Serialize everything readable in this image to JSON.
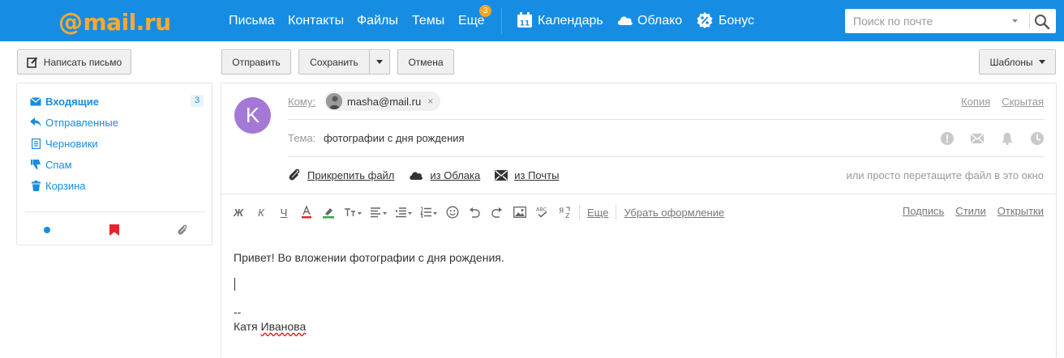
{
  "header": {
    "logo": {
      "at": "@",
      "name": "mail",
      "domain": ".ru"
    },
    "nav": [
      {
        "label": "Письма"
      },
      {
        "label": "Контакты"
      },
      {
        "label": "Файлы"
      },
      {
        "label": "Темы"
      },
      {
        "label": "Еще",
        "badge": "3"
      }
    ],
    "services": [
      {
        "label": "Календарь",
        "icon": "calendar-icon",
        "icon_text": "11"
      },
      {
        "label": "Облако",
        "icon": "cloud-icon"
      },
      {
        "label": "Бонус",
        "icon": "bonus-percent-icon"
      }
    ],
    "search": {
      "placeholder": "Поиск по почте"
    },
    "colors": {
      "bar": "#168de2",
      "logo": "#ffa930",
      "badge": "#f5a623"
    }
  },
  "toolbar": {
    "write_label": "Написать письмо",
    "send_label": "Отправить",
    "save_label": "Сохранить",
    "cancel_label": "Отмена",
    "templates_label": "Шаблоны"
  },
  "sidebar": {
    "folders": [
      {
        "label": "Входящие",
        "count": "3",
        "icon": "inbox-icon",
        "active": true
      },
      {
        "label": "Отправленные",
        "icon": "sent-icon"
      },
      {
        "label": "Черновики",
        "icon": "drafts-icon"
      },
      {
        "label": "Спам",
        "icon": "spam-icon"
      },
      {
        "label": "Корзина",
        "icon": "trash-icon"
      }
    ],
    "filters": [
      "unread-dot-icon",
      "flag-icon",
      "attachment-icon"
    ]
  },
  "compose": {
    "avatar_letter": "K",
    "to_label": "Кому:",
    "recipient": "masha@mail.ru",
    "remove_symbol": "×",
    "copy_label": "Копия",
    "bcc_label": "Скрытая",
    "subject_label": "Тема:",
    "subject": "фотографии с дня рождения",
    "attach_file_label": "Прикрепить файл",
    "from_cloud_label": "из Облака",
    "from_mail_label": "из Почты",
    "drop_hint": "или просто перетащите файл в это окно",
    "editor": {
      "more_label": "Еще",
      "clear_format_label": "Убрать оформление",
      "signature_label": "Подпись",
      "styles_label": "Стили",
      "postcards_label": "Открытки"
    },
    "body": {
      "text": "Привет! Во вложении фотографии с дня рождения.",
      "sig_dash": "--",
      "sig_first": "Катя",
      "sig_last": "Иванова"
    }
  }
}
